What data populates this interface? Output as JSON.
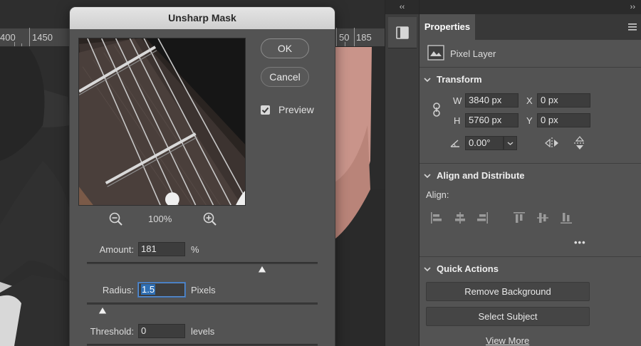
{
  "ruler": {
    "labels": [
      "400",
      "1450",
      "50",
      "185"
    ]
  },
  "dialog": {
    "title": "Unsharp Mask",
    "ok_label": "OK",
    "cancel_label": "Cancel",
    "preview_label": "Preview",
    "preview_checked": true,
    "zoom": "100%",
    "amount": {
      "label": "Amount:",
      "value": "181",
      "unit": "%"
    },
    "radius": {
      "label": "Radius:",
      "value": "1.5",
      "unit": "Pixels"
    },
    "threshold": {
      "label": "Threshold:",
      "value": "0",
      "unit": "levels"
    }
  },
  "panel": {
    "collapse_left": "‹‹",
    "collapse_right": "››",
    "tab": "Properties",
    "layer_type": "Pixel Layer",
    "transform": {
      "title": "Transform",
      "w_label": "W",
      "w": "3840 px",
      "h_label": "H",
      "h": "5760 px",
      "x_label": "X",
      "x": "0 px",
      "y_label": "Y",
      "y": "0 px",
      "angle": "0.00°"
    },
    "align": {
      "title": "Align and Distribute",
      "sub": "Align:",
      "more": "•••"
    },
    "quick_actions": {
      "title": "Quick Actions",
      "remove_bg": "Remove Background",
      "select_subject": "Select Subject",
      "view_more": "View More"
    }
  },
  "colors": {
    "dialog_bg": "#535353",
    "panel_bg": "#535353",
    "accent_selection": "#2f6fb4"
  }
}
